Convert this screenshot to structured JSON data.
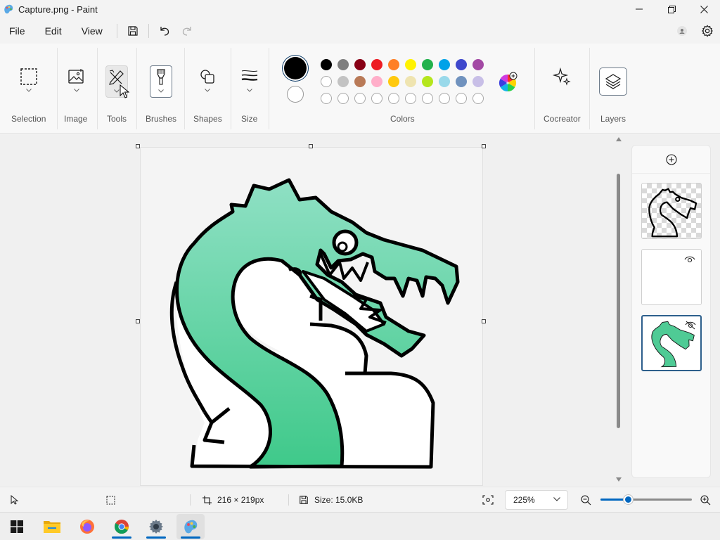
{
  "window": {
    "title": "Capture.png - Paint"
  },
  "menu": {
    "file": "File",
    "edit": "Edit",
    "view": "View"
  },
  "ribbon": {
    "groups": {
      "selection": "Selection",
      "image": "Image",
      "tools": "Tools",
      "brushes": "Brushes",
      "shapes": "Shapes",
      "size": "Size",
      "colors": "Colors",
      "cocreator": "Cocreator",
      "layers": "Layers"
    },
    "primary_color": "#000000",
    "secondary_color": "#ffffff",
    "palette_row1": [
      "#000000",
      "#7f7f7f",
      "#880015",
      "#ed1c24",
      "#ff7f27",
      "#fff200",
      "#22b14c",
      "#00a2e8",
      "#3f48cc",
      "#a349a4"
    ],
    "palette_row2": [
      "#ffffff",
      "#c3c3c3",
      "#b97a57",
      "#ffaec9",
      "#ffc90e",
      "#efe4b0",
      "#b5e61d",
      "#99d9ea",
      "#7092be",
      "#c8bfe7"
    ],
    "palette_row3_count": 10
  },
  "canvas": {
    "dragon_fill": "#5fd0a0",
    "outline": "#000000"
  },
  "layers_panel": {
    "layer_count": 3,
    "selected_index": 2
  },
  "status": {
    "canvas_size": "216 × 219px",
    "file_size": "Size: 15.0KB",
    "zoom": "225%",
    "zoom_slider_fraction": 0.3
  },
  "accent_color": "#0067c0"
}
